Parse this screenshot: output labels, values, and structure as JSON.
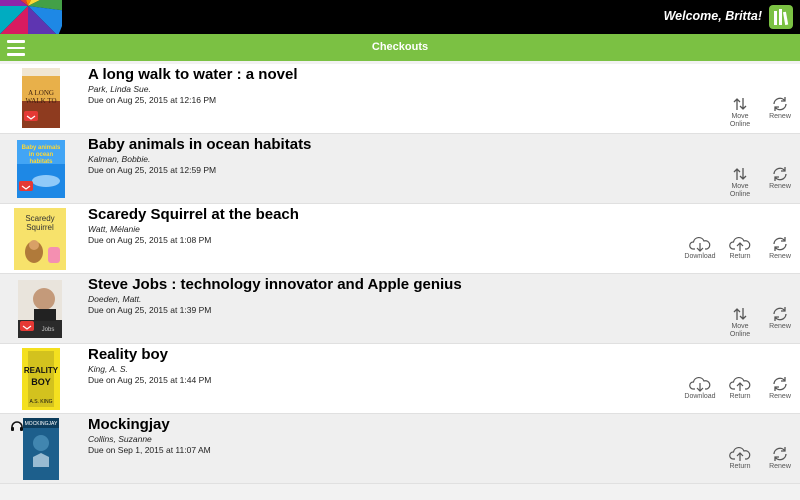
{
  "header": {
    "welcome": "Welcome, Britta!",
    "title": "Checkouts"
  },
  "checkouts": [
    {
      "title": "A long walk to water : a novel",
      "author": "Park, Linda Sue.",
      "due": "Due on Aug 25, 2015 at 12:16 PM",
      "actions": [
        "Move Online",
        "Renew"
      ]
    },
    {
      "title": "Baby animals in ocean habitats",
      "author": "Kalman, Bobbie.",
      "due": "Due on Aug 25, 2015 at 12:59 PM",
      "actions": [
        "Move Online",
        "Renew"
      ]
    },
    {
      "title": "Scaredy Squirrel at the beach",
      "author": "Watt, Mélanie",
      "due": "Due on Aug 25, 2015 at 1:08 PM",
      "actions": [
        "Download",
        "Return",
        "Renew"
      ]
    },
    {
      "title": "Steve Jobs : technology innovator and Apple genius",
      "author": "Doeden, Matt.",
      "due": "Due on Aug 25, 2015 at 1:39 PM",
      "actions": [
        "Move Online",
        "Renew"
      ]
    },
    {
      "title": "Reality boy",
      "author": "King, A. S.",
      "due": "Due on Aug 25, 2015 at 1:44 PM",
      "actions": [
        "Download",
        "Return",
        "Renew"
      ]
    },
    {
      "title": "Mockingjay",
      "author": "Collins, Suzanne",
      "due": "Due on Sep 1, 2015 at 11:07 AM",
      "actions": [
        "Return",
        "Renew"
      ]
    }
  ],
  "labels": {
    "move_online_1": "Move",
    "move_online_2": "Online",
    "renew": "Renew",
    "download": "Download",
    "return": "Return"
  },
  "colors": {
    "accent_green": "#7bc143",
    "topbar": "#000000"
  },
  "icons": {
    "menu": "hamburger-icon",
    "audiobook": "headphones-icon"
  }
}
